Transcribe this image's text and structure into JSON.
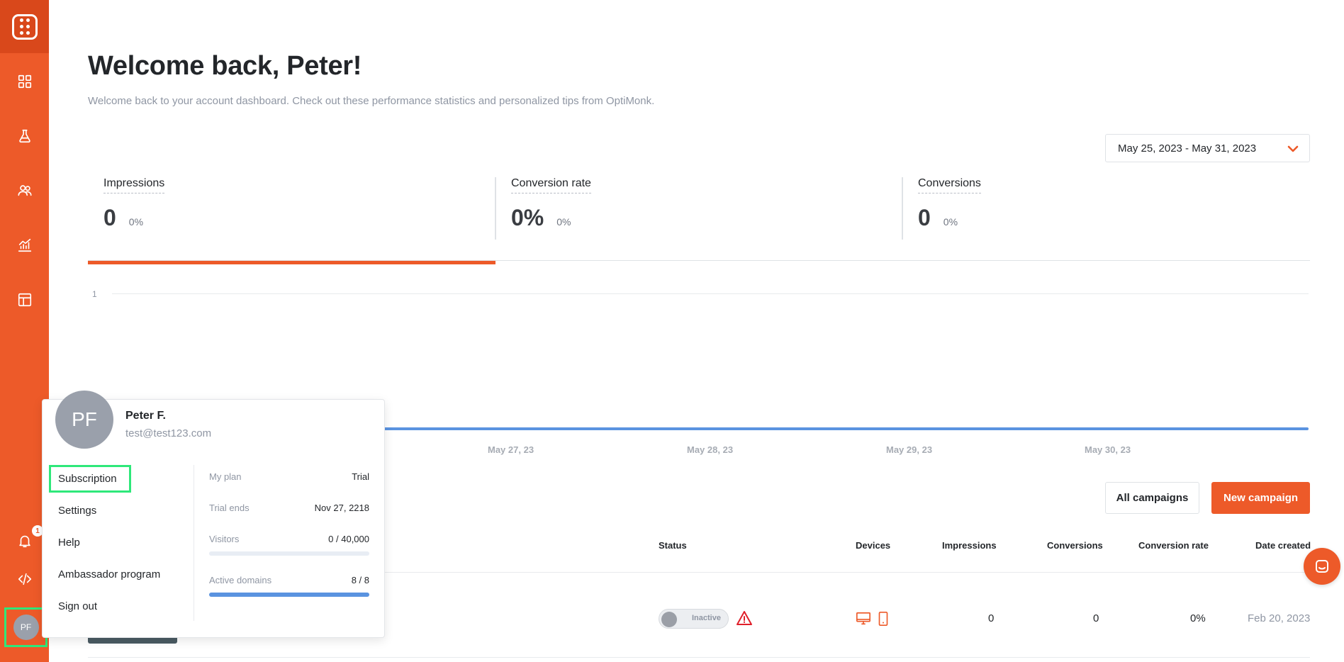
{
  "colors": {
    "accent": "#ed5a29",
    "accent_dark": "#d9481b",
    "chart_line": "#5a93e0",
    "highlight": "#2ee87a"
  },
  "sidebar": {
    "logo_icon": "optimonk-logo-icon",
    "items": [
      {
        "icon": "dashboard-grid-icon"
      },
      {
        "icon": "flask-icon"
      },
      {
        "icon": "users-icon"
      },
      {
        "icon": "analytics-chart-icon"
      },
      {
        "icon": "templates-layout-icon"
      }
    ],
    "notifications_icon": "bell-icon",
    "notification_count": "1",
    "code_icon": "code-icon",
    "avatar_initials": "PF"
  },
  "header": {
    "title": "Welcome back, Peter!",
    "subtitle": "Welcome back to your account dashboard. Check out these performance statistics and personalized tips from OptiMonk."
  },
  "date_range": "May 25, 2023 - May 31, 2023",
  "stats": [
    {
      "label": "Impressions",
      "value": "0",
      "change": "0%"
    },
    {
      "label": "Conversion rate",
      "value": "0%",
      "change": "0%"
    },
    {
      "label": "Conversions",
      "value": "0",
      "change": "0%"
    }
  ],
  "chart_data": {
    "type": "line",
    "y_ticks": [
      "1"
    ],
    "x_ticks": [
      "May 27, 23",
      "May 28, 23",
      "May 29, 23",
      "May 30, 23"
    ],
    "series": [
      {
        "values": [
          0,
          0,
          0,
          0,
          0,
          0,
          0
        ]
      }
    ]
  },
  "buttons": {
    "all_campaigns": "All campaigns",
    "new_campaign": "New campaign"
  },
  "table": {
    "headers": {
      "status": "Status",
      "devices": "Devices",
      "impressions": "Impressions",
      "conversions": "Conversions",
      "conversion_rate": "Conversion rate",
      "date_created": "Date created"
    },
    "rows": [
      {
        "status": "Inactive",
        "impressions": "0",
        "conversions": "0",
        "conversion_rate": "0%",
        "date_created": "Feb 20, 2023"
      }
    ]
  },
  "popup": {
    "avatar_initials": "PF",
    "name": "Peter F.",
    "email": "test@test123.com",
    "menu": [
      "Subscription",
      "Settings",
      "Help",
      "Ambassador program",
      "Sign out"
    ],
    "plan": {
      "my_plan_label": "My plan",
      "my_plan_value": "Trial",
      "trial_ends_label": "Trial ends",
      "trial_ends_value": "Nov 27, 2218",
      "visitors_label": "Visitors",
      "visitors_value": "0 / 40,000",
      "visitors_fraction": 0,
      "domains_label": "Active domains",
      "domains_value": "8 / 8",
      "domains_fraction": 1
    }
  }
}
